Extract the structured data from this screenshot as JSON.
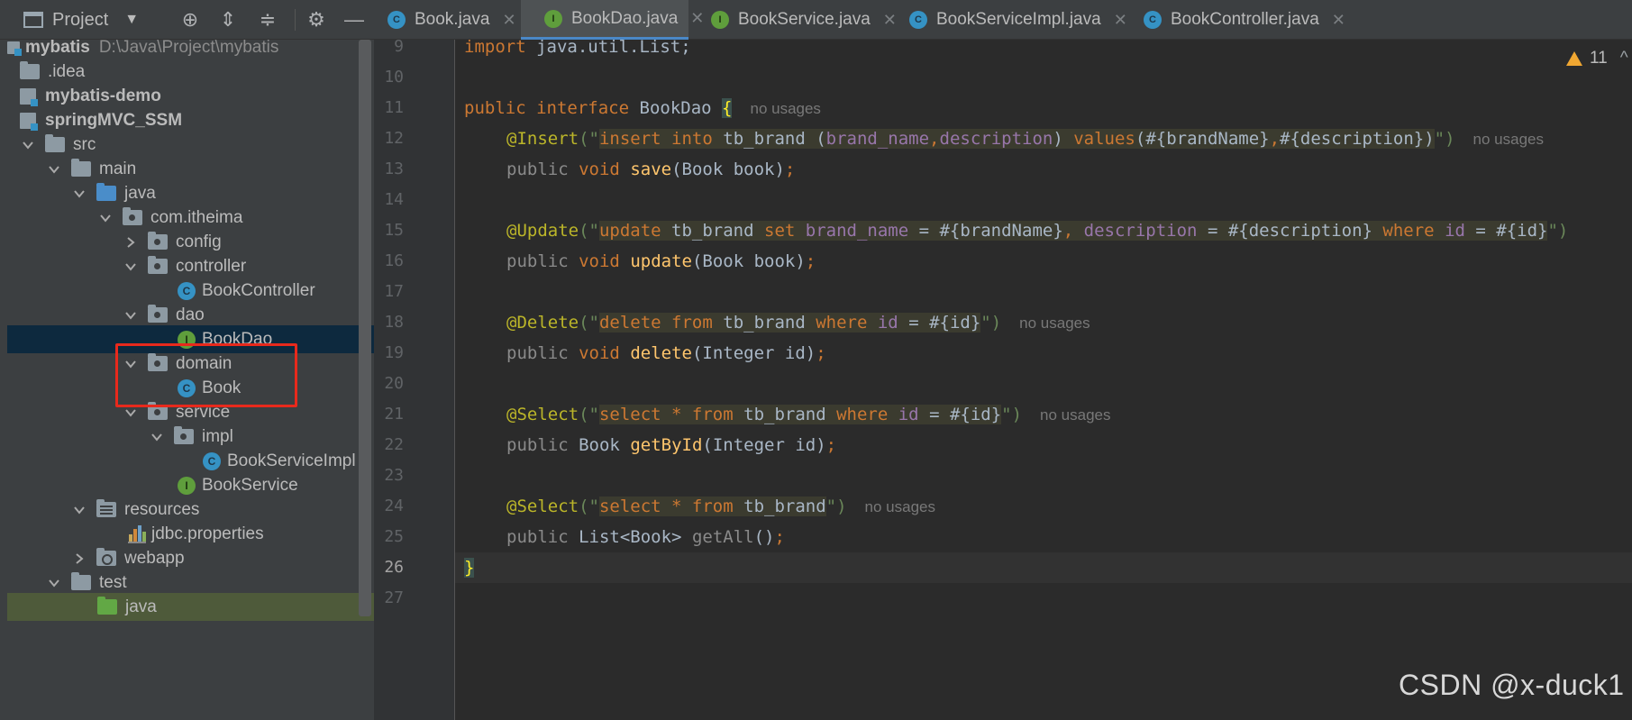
{
  "project_panel": {
    "title": "Project",
    "tree": [
      {
        "label": "mybatis",
        "path": "D:\\Java\\Project\\mybatis"
      },
      {
        "label": ".idea"
      },
      {
        "label": "mybatis-demo"
      },
      {
        "label": "springMVC_SSM"
      },
      {
        "label": "src"
      },
      {
        "label": "main"
      },
      {
        "label": "java"
      },
      {
        "label": "com.itheima"
      },
      {
        "label": "config"
      },
      {
        "label": "controller"
      },
      {
        "label": "BookController"
      },
      {
        "label": "dao"
      },
      {
        "label": "BookDao"
      },
      {
        "label": "domain"
      },
      {
        "label": "Book"
      },
      {
        "label": "service"
      },
      {
        "label": "impl"
      },
      {
        "label": "BookServiceImpl"
      },
      {
        "label": "BookService"
      },
      {
        "label": "resources"
      },
      {
        "label": "jdbc.properties"
      },
      {
        "label": "webapp"
      },
      {
        "label": "test"
      },
      {
        "label": "java"
      }
    ]
  },
  "tabs": [
    {
      "label": "Book.java",
      "badge": "C"
    },
    {
      "label": "BookDao.java",
      "badge": "I"
    },
    {
      "label": "BookService.java",
      "badge": "I"
    },
    {
      "label": "BookServiceImpl.java",
      "badge": "C"
    },
    {
      "label": "BookController.java",
      "badge": "C"
    }
  ],
  "editor": {
    "line_numbers": [
      "9",
      "10",
      "11",
      "12",
      "13",
      "14",
      "15",
      "16",
      "17",
      "18",
      "19",
      "20",
      "21",
      "22",
      "23",
      "24",
      "25",
      "26",
      "27"
    ],
    "current_line": "26",
    "code": {
      "l9_kw": "import",
      "l9_rest": " java.util.List;",
      "l11_kw1": "public",
      "l11_kw2": "interface",
      "l11_name": "BookDao",
      "l11_brace": "{",
      "hint": "no usages",
      "l12_ann": "@Insert",
      "l12_p1": "(\"",
      "l12_s1": "insert into",
      "l12_s2": " tb_brand (",
      "l12_s3": "brand_name",
      "l12_s4": ",",
      "l12_s5": "description",
      "l12_s6": ") ",
      "l12_s7": "values",
      "l12_s8": "(#{brandName}",
      "l12_s9": ",",
      "l12_s10": "#{description})",
      "l12_p2": "\")",
      "l13_kw1": "public",
      "l13_kw2": "void",
      "l13_fn": "save",
      "l13_rest": "(Book book)",
      "semi": ";",
      "l15_ann": "@Update",
      "l15_p1": "(\"",
      "l15_s1": "update",
      "l15_s2": " tb_brand ",
      "l15_s3": "set",
      "l15_s4": " ",
      "l15_s5": "brand_name",
      "l15_s6": " = #{brandName}",
      "l15_s7": ", ",
      "l15_s8": "description",
      "l15_s9": " = #{description} ",
      "l15_s10": "where",
      "l15_s11": " ",
      "l15_s12": "id",
      "l15_s13": " = #{id}",
      "l15_p2": "\")",
      "l16_kw1": "public",
      "l16_kw2": "void",
      "l16_fn": "update",
      "l16_rest": "(Book book)",
      "l18_ann": "@Delete",
      "l18_p1": "(\"",
      "l18_s1": "delete from",
      "l18_s2": " tb_brand ",
      "l18_s3": "where",
      "l18_s4": " ",
      "l18_s5": "id",
      "l18_s6": " = #{id}",
      "l18_p2": "\")",
      "l19_kw1": "public",
      "l19_kw2": "void",
      "l19_fn": "delete",
      "l19_rest": "(Integer id)",
      "l21_ann": "@Select",
      "l21_p1": "(\"",
      "l21_s1": "select * from",
      "l21_s2": " tb_brand ",
      "l21_s3": "where",
      "l21_s4": " ",
      "l21_s5": "id",
      "l21_s6": " = #{id}",
      "l21_p2": "\")",
      "l22_kw1": "public",
      "l22_type": "Book",
      "l22_fn": "getById",
      "l22_rest": "(Integer id)",
      "l24_ann": "@Select",
      "l24_p1": "(\"",
      "l24_s1": "select * from",
      "l24_s2": " tb_brand",
      "l24_p2": "\")",
      "l25_kw1": "public",
      "l25_type": "List<Book>",
      "l25_fn": "getAll",
      "l25_rest": "()",
      "l26_brace": "}"
    }
  },
  "warnings": {
    "count": "11"
  },
  "watermark": "CSDN @x-duck1",
  "colors": {
    "highlight_box": "#e8291c",
    "selection": "#0d293e",
    "accent": "#4a88c7"
  }
}
